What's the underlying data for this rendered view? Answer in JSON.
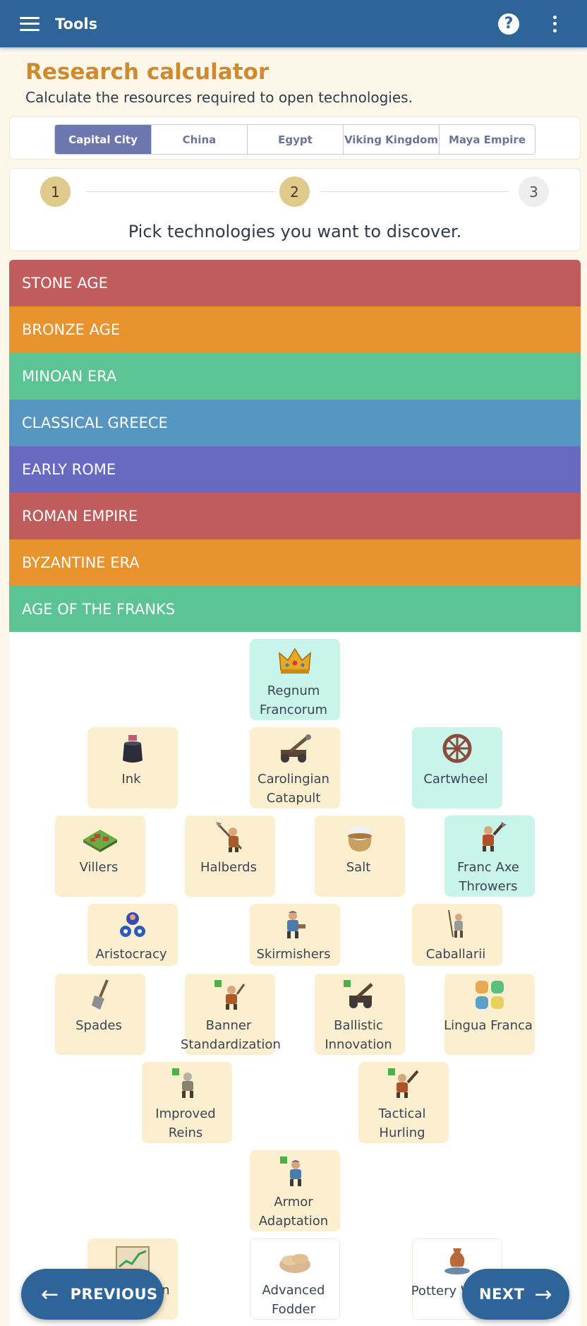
{
  "topbar": {
    "title": "Tools",
    "help_icon": "?"
  },
  "header": {
    "title": "Research calculator",
    "subtitle": "Calculate the resources required to open technologies."
  },
  "cities": [
    "Capital City",
    "China",
    "Egypt",
    "Viking Kingdom",
    "Maya Empire"
  ],
  "active_city": "Capital City",
  "steps": {
    "one": "1",
    "two": "2",
    "three": "3",
    "current": 2,
    "instruction": "Pick technologies you want to discover."
  },
  "eras": [
    {
      "label": "STONE AGE",
      "color": "#c05c5c"
    },
    {
      "label": "BRONZE AGE",
      "color": "#e8932e"
    },
    {
      "label": "MINOAN ERA",
      "color": "#5cc494"
    },
    {
      "label": "CLASSICAL GREECE",
      "color": "#5896c2"
    },
    {
      "label": "EARLY ROME",
      "color": "#6869c1"
    },
    {
      "label": "ROMAN EMPIRE",
      "color": "#c05c5c"
    },
    {
      "label": "BYZANTINE ERA",
      "color": "#e8932e"
    },
    {
      "label": "AGE OF THE FRANKS",
      "color": "#5cc494"
    }
  ],
  "techs": {
    "regnum": {
      "name": "Regnum Francorum",
      "selected": true,
      "icon": "crown-icon"
    },
    "ink": {
      "name": "Ink",
      "selected": false,
      "icon": "ink-bottle-icon"
    },
    "catapult": {
      "name": "Carolingian Catapult",
      "selected": false,
      "icon": "catapult-icon"
    },
    "cartwheel": {
      "name": "Cartwheel",
      "selected": true,
      "icon": "wheel-icon"
    },
    "villers": {
      "name": "Villers",
      "selected": false,
      "icon": "village-icon"
    },
    "halberds": {
      "name": "Halberds",
      "selected": false,
      "icon": "halberdier-icon"
    },
    "salt": {
      "name": "Salt",
      "selected": false,
      "icon": "salt-sack-icon"
    },
    "franc_axe": {
      "name": "Franc Axe Throwers",
      "selected": true,
      "icon": "axe-thrower-icon"
    },
    "aristocracy": {
      "name": "Aristocracy",
      "selected": false,
      "icon": "nobles-icon"
    },
    "skirmishers": {
      "name": "Skirmishers",
      "selected": false,
      "icon": "skirmisher-icon"
    },
    "caballarii": {
      "name": "Caballarii",
      "selected": false,
      "icon": "cavalry-icon"
    },
    "spades": {
      "name": "Spades",
      "selected": false,
      "icon": "spade-icon"
    },
    "banner": {
      "name": "Banner Standardization",
      "selected": false,
      "icon": "banner-soldier-icon"
    },
    "ballistic": {
      "name": "Ballistic Innovation",
      "selected": false,
      "icon": "ballista-icon"
    },
    "lingua": {
      "name": "Lingua Franca",
      "selected": false,
      "icon": "tiles-icon"
    },
    "reins": {
      "name": "Improved Reins",
      "selected": false,
      "icon": "rider-upgrade-icon"
    },
    "hurling": {
      "name": "Tactical Hurling",
      "selected": false,
      "icon": "thrower-upgrade-icon"
    },
    "armor": {
      "name": "Armor Adaptation",
      "selected": false,
      "icon": "armor-upgrade-icon"
    },
    "growth": {
      "name": "Growth Plan",
      "selected": false,
      "icon": "chart-board-icon"
    },
    "fodder": {
      "name": "Advanced Fodder",
      "selected": false,
      "icon": "hay-icon"
    },
    "pottery": {
      "name": "Pottery Wheel",
      "selected": false,
      "icon": "pottery-icon"
    }
  },
  "buttons": {
    "previous": "PREVIOUS",
    "next": "NEXT"
  },
  "colors": {
    "topbar": "#2e6497",
    "title": "#d08a2e",
    "tech_available": "#fcefcf",
    "tech_selected": "#c8f4ea"
  }
}
